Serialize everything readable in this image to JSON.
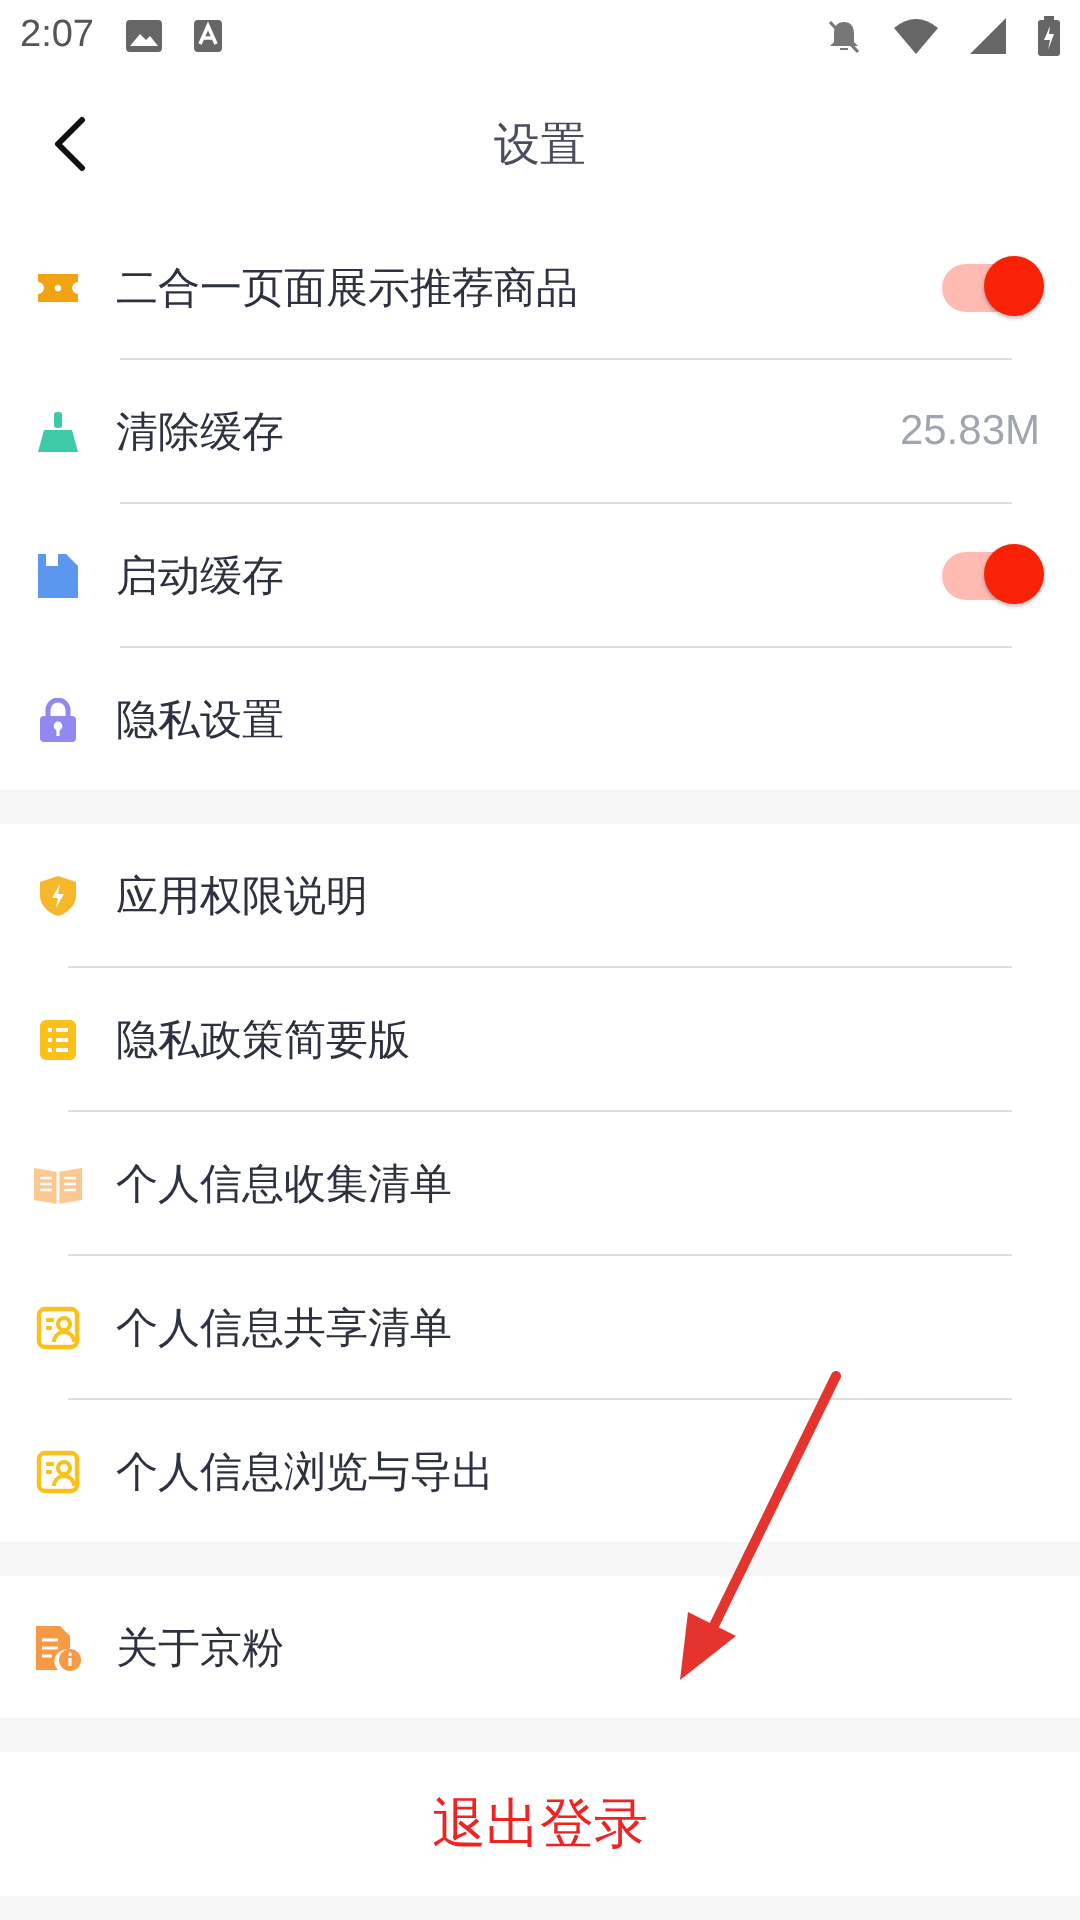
{
  "status_bar": {
    "time": "2:07"
  },
  "header": {
    "title": "设置"
  },
  "groups": [
    {
      "items": [
        {
          "kind": "toggle",
          "label": "二合一页面展示推荐商品",
          "on": true
        },
        {
          "kind": "value",
          "label": "清除缓存",
          "value": "25.83M"
        },
        {
          "kind": "toggle",
          "label": "启动缓存",
          "on": true
        },
        {
          "kind": "plain",
          "label": "隐私设置"
        }
      ]
    },
    {
      "items": [
        {
          "kind": "plain",
          "label": "应用权限说明"
        },
        {
          "kind": "plain",
          "label": "隐私政策简要版"
        },
        {
          "kind": "plain",
          "label": "个人信息收集清单"
        },
        {
          "kind": "plain",
          "label": "个人信息共享清单"
        },
        {
          "kind": "plain",
          "label": "个人信息浏览与导出"
        }
      ]
    },
    {
      "items": [
        {
          "kind": "plain",
          "label": "关于京粉"
        }
      ]
    }
  ],
  "logout": {
    "label": "退出登录"
  }
}
